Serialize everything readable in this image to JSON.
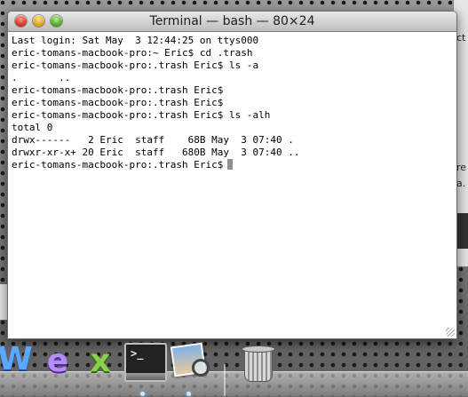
{
  "window": {
    "title": "Terminal — bash — 80×24"
  },
  "console": {
    "lines": [
      "Last login: Sat May  3 12:44:25 on ttys000",
      "eric-tomans-macbook-pro:~ Eric$ cd .trash",
      "eric-tomans-macbook-pro:.trash Eric$ ls -a",
      ".       ..",
      "eric-tomans-macbook-pro:.trash Eric$",
      "eric-tomans-macbook-pro:.trash Eric$",
      "eric-tomans-macbook-pro:.trash Eric$ ls -alh",
      "total 0",
      "drwx------   2 Eric  staff    68B May  3 07:40 .",
      "drwxr-xr-x+ 20 Eric  staff   680B May  3 07:40 ..",
      "eric-tomans-macbook-pro:.trash Eric$"
    ]
  },
  "background_window": {
    "fragments": [
      "ct",
      "re",
      "a."
    ]
  },
  "dock": {
    "items": [
      {
        "glyph": "W",
        "icon": "word-icon"
      },
      {
        "glyph": "e",
        "icon": "entourage-icon"
      },
      {
        "glyph": "x",
        "icon": "excel-icon"
      },
      {
        "glyph": ">_",
        "icon": "terminal-icon"
      },
      {
        "icon": "preview-icon"
      },
      {
        "icon": "trash-icon"
      }
    ]
  },
  "colors": {
    "close": "#d1281b",
    "minimize": "#d79c12",
    "zoom": "#3f9e1e",
    "cursor": "#909090"
  }
}
